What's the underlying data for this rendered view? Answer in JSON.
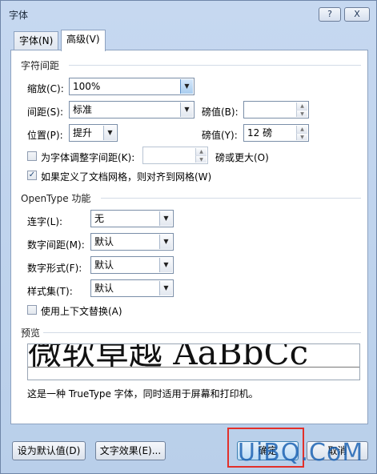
{
  "window": {
    "title": "字体",
    "help": "?",
    "close": "X"
  },
  "tabs": [
    {
      "label": "字体(N)"
    },
    {
      "label": "高级(V)"
    }
  ],
  "char_spacing": {
    "title": "字符间距",
    "scale_label": "缩放(C):",
    "scale_value": "100%",
    "spacing_label": "间距(S):",
    "spacing_value": "标准",
    "spacing_by_label": "磅值(B):",
    "spacing_by_value": "",
    "position_label": "位置(P):",
    "position_value": "提升",
    "position_by_label": "磅值(Y):",
    "position_by_value": "12 磅",
    "kerning_label": "为字体调整字间距(K):",
    "kerning_checked": false,
    "kerning_value": "",
    "kerning_suffix": "磅或更大(O)",
    "grid_label": "如果定义了文档网格，则对齐到网格(W)",
    "grid_checked": true
  },
  "opentype": {
    "title": "OpenType 功能",
    "ligatures_label": "连字(L):",
    "ligatures_value": "无",
    "num_spacing_label": "数字间距(M):",
    "num_spacing_value": "默认",
    "num_forms_label": "数字形式(F):",
    "num_forms_value": "默认",
    "stylistic_label": "样式集(T):",
    "stylistic_value": "默认",
    "contextual_label": "使用上下文替换(A)",
    "contextual_checked": false
  },
  "preview": {
    "title": "预览",
    "sample": "微软卓越 AaBbCc",
    "description": "这是一种 TrueType 字体，同时适用于屏幕和打印机。"
  },
  "buttons": {
    "set_default": "设为默认值(D)",
    "text_effects": "文字效果(E)...",
    "ok": "确定",
    "cancel": "取消"
  },
  "watermark": "UiBQ.CoM"
}
